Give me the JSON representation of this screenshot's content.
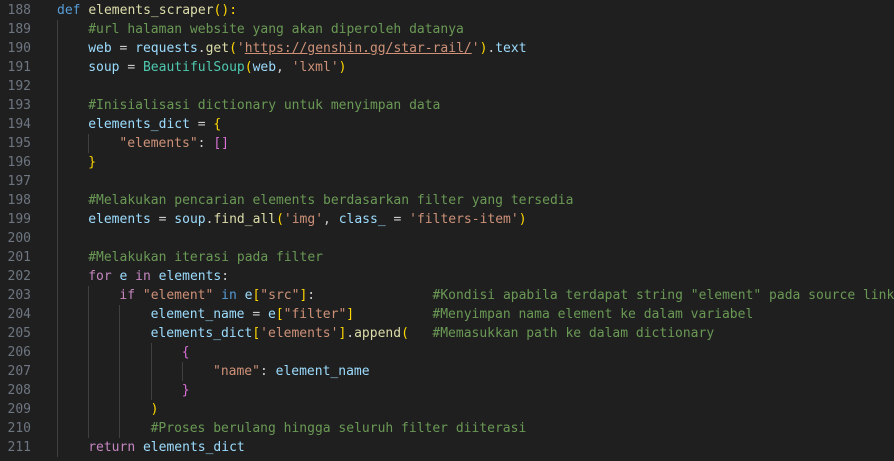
{
  "editor": {
    "theme": {
      "background": "#1f1f1f",
      "line_number": "#6e7681",
      "keyword": "#569cd6",
      "control": "#c586c0",
      "function": "#dcdcaa",
      "variable": "#9cdcfe",
      "string": "#ce9178",
      "comment": "#6a9955",
      "class": "#4ec9b0",
      "bracket_1": "#ffd700",
      "bracket_2": "#da70d6",
      "bracket_3": "#179fff"
    },
    "lines": [
      {
        "number": "188",
        "indent": 0,
        "tokens": [
          {
            "t": "def",
            "k": "keyword"
          },
          {
            "t": " ",
            "k": "plain"
          },
          {
            "t": "elements_scraper",
            "k": "function"
          },
          {
            "t": "():",
            "k": "bracket-1"
          }
        ]
      },
      {
        "number": "189",
        "indent": 1,
        "tokens": [
          {
            "t": "#url halaman website yang akan diperoleh datanya",
            "k": "comment"
          }
        ]
      },
      {
        "number": "190",
        "indent": 1,
        "tokens": [
          {
            "t": "web",
            "k": "variable"
          },
          {
            "t": " = ",
            "k": "plain"
          },
          {
            "t": "requests",
            "k": "variable"
          },
          {
            "t": ".",
            "k": "plain"
          },
          {
            "t": "get",
            "k": "function"
          },
          {
            "t": "(",
            "k": "bracket-1"
          },
          {
            "t": "'",
            "k": "string"
          },
          {
            "t": "https://genshin.gg/star-rail/",
            "k": "url"
          },
          {
            "t": "'",
            "k": "string"
          },
          {
            "t": ")",
            "k": "bracket-1"
          },
          {
            "t": ".",
            "k": "plain"
          },
          {
            "t": "text",
            "k": "variable"
          }
        ]
      },
      {
        "number": "191",
        "indent": 1,
        "tokens": [
          {
            "t": "soup",
            "k": "variable"
          },
          {
            "t": " = ",
            "k": "plain"
          },
          {
            "t": "BeautifulSoup",
            "k": "class"
          },
          {
            "t": "(",
            "k": "bracket-1"
          },
          {
            "t": "web",
            "k": "variable"
          },
          {
            "t": ", ",
            "k": "plain"
          },
          {
            "t": "'lxml'",
            "k": "string"
          },
          {
            "t": ")",
            "k": "bracket-1"
          }
        ]
      },
      {
        "number": "192",
        "indent": 1,
        "tokens": []
      },
      {
        "number": "193",
        "indent": 1,
        "tokens": [
          {
            "t": "#Inisialisasi dictionary untuk menyimpan data",
            "k": "comment"
          }
        ]
      },
      {
        "number": "194",
        "indent": 1,
        "tokens": [
          {
            "t": "elements_dict",
            "k": "variable"
          },
          {
            "t": " = ",
            "k": "plain"
          },
          {
            "t": "{",
            "k": "bracket-1"
          }
        ]
      },
      {
        "number": "195",
        "indent": 2,
        "tokens": [
          {
            "t": "\"elements\"",
            "k": "string"
          },
          {
            "t": ": ",
            "k": "plain"
          },
          {
            "t": "[]",
            "k": "bracket-2"
          }
        ]
      },
      {
        "number": "196",
        "indent": 1,
        "tokens": [
          {
            "t": "}",
            "k": "bracket-1"
          }
        ]
      },
      {
        "number": "197",
        "indent": 1,
        "tokens": []
      },
      {
        "number": "198",
        "indent": 1,
        "tokens": [
          {
            "t": "#Melakukan pencarian elements berdasarkan filter yang tersedia",
            "k": "comment"
          }
        ]
      },
      {
        "number": "199",
        "indent": 1,
        "tokens": [
          {
            "t": "elements",
            "k": "variable"
          },
          {
            "t": " = ",
            "k": "plain"
          },
          {
            "t": "soup",
            "k": "variable"
          },
          {
            "t": ".",
            "k": "plain"
          },
          {
            "t": "find_all",
            "k": "function"
          },
          {
            "t": "(",
            "k": "bracket-1"
          },
          {
            "t": "'img'",
            "k": "string"
          },
          {
            "t": ", ",
            "k": "plain"
          },
          {
            "t": "class_",
            "k": "variable"
          },
          {
            "t": " = ",
            "k": "plain"
          },
          {
            "t": "'filters-item'",
            "k": "string"
          },
          {
            "t": ")",
            "k": "bracket-1"
          }
        ]
      },
      {
        "number": "200",
        "indent": 1,
        "tokens": []
      },
      {
        "number": "201",
        "indent": 1,
        "tokens": [
          {
            "t": "#Melakukan iterasi pada filter",
            "k": "comment"
          }
        ]
      },
      {
        "number": "202",
        "indent": 1,
        "tokens": [
          {
            "t": "for",
            "k": "control"
          },
          {
            "t": " ",
            "k": "plain"
          },
          {
            "t": "e",
            "k": "variable"
          },
          {
            "t": " ",
            "k": "plain"
          },
          {
            "t": "in",
            "k": "control"
          },
          {
            "t": " ",
            "k": "plain"
          },
          {
            "t": "elements",
            "k": "variable"
          },
          {
            "t": ":",
            "k": "plain"
          }
        ]
      },
      {
        "number": "203",
        "indent": 2,
        "tokens": [
          {
            "t": "if",
            "k": "control"
          },
          {
            "t": " ",
            "k": "plain"
          },
          {
            "t": "\"element\"",
            "k": "string"
          },
          {
            "t": " ",
            "k": "plain"
          },
          {
            "t": "in",
            "k": "keyword"
          },
          {
            "t": " ",
            "k": "plain"
          },
          {
            "t": "e",
            "k": "variable"
          },
          {
            "t": "[",
            "k": "bracket-1"
          },
          {
            "t": "\"src\"",
            "k": "string"
          },
          {
            "t": "]",
            "k": "bracket-1"
          },
          {
            "t": ":",
            "k": "plain"
          },
          {
            "t": "               ",
            "k": "plain"
          },
          {
            "t": "#Kondisi apabila terdapat string \"element\" pada source link",
            "k": "comment"
          }
        ]
      },
      {
        "number": "204",
        "indent": 3,
        "tokens": [
          {
            "t": "element_name",
            "k": "variable"
          },
          {
            "t": " = ",
            "k": "plain"
          },
          {
            "t": "e",
            "k": "variable"
          },
          {
            "t": "[",
            "k": "bracket-1"
          },
          {
            "t": "\"filter\"",
            "k": "string"
          },
          {
            "t": "]",
            "k": "bracket-1"
          },
          {
            "t": "          ",
            "k": "plain"
          },
          {
            "t": "#Menyimpan nama element ke dalam variabel",
            "k": "comment"
          }
        ]
      },
      {
        "number": "205",
        "indent": 3,
        "tokens": [
          {
            "t": "elements_dict",
            "k": "variable"
          },
          {
            "t": "[",
            "k": "bracket-1"
          },
          {
            "t": "'elements'",
            "k": "string"
          },
          {
            "t": "]",
            "k": "bracket-1"
          },
          {
            "t": ".",
            "k": "plain"
          },
          {
            "t": "append",
            "k": "function"
          },
          {
            "t": "(",
            "k": "bracket-1"
          },
          {
            "t": "   ",
            "k": "plain"
          },
          {
            "t": "#Memasukkan path ke dalam dictionary",
            "k": "comment"
          }
        ]
      },
      {
        "number": "206",
        "indent": 4,
        "tokens": [
          {
            "t": "{",
            "k": "bracket-2"
          }
        ]
      },
      {
        "number": "207",
        "indent": 5,
        "tokens": [
          {
            "t": "\"name\"",
            "k": "string"
          },
          {
            "t": ": ",
            "k": "plain"
          },
          {
            "t": "element_name",
            "k": "variable"
          }
        ]
      },
      {
        "number": "208",
        "indent": 4,
        "tokens": [
          {
            "t": "}",
            "k": "bracket-2"
          }
        ]
      },
      {
        "number": "209",
        "indent": 3,
        "tokens": [
          {
            "t": ")",
            "k": "bracket-1"
          }
        ]
      },
      {
        "number": "210",
        "indent": 3,
        "tokens": [
          {
            "t": "#Proses berulang hingga seluruh filter diiterasi",
            "k": "comment"
          }
        ]
      },
      {
        "number": "211",
        "indent": 1,
        "tokens": [
          {
            "t": "return",
            "k": "control"
          },
          {
            "t": " ",
            "k": "plain"
          },
          {
            "t": "elements_dict",
            "k": "variable"
          }
        ]
      }
    ]
  }
}
